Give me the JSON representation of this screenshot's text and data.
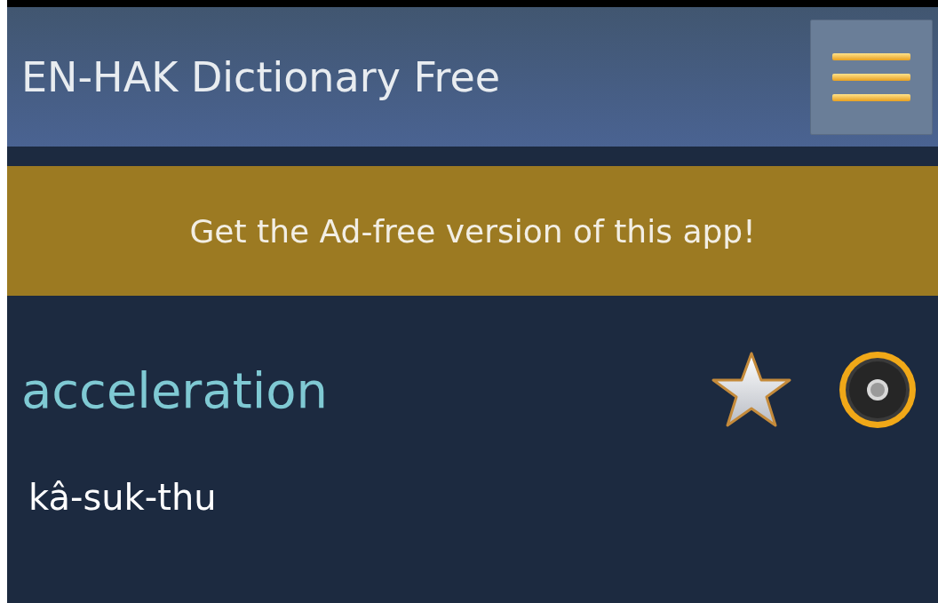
{
  "app_bar": {
    "title": "EN-HAK Dictionary Free"
  },
  "banner": {
    "text": "Get the Ad-free version of this app!"
  },
  "entry": {
    "word": "acceleration",
    "translation": "kâ-suk-thu"
  }
}
